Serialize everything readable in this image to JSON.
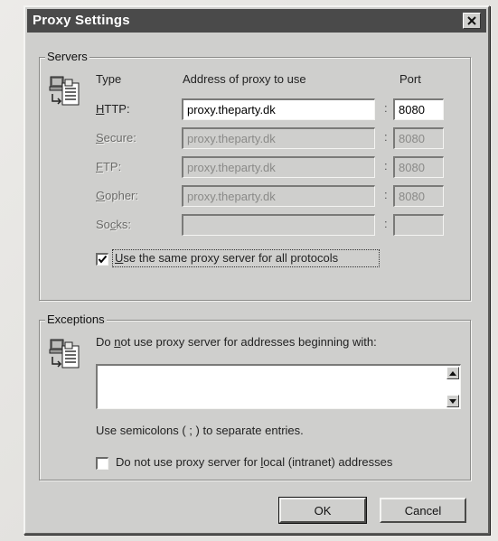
{
  "window": {
    "title": "Proxy Settings",
    "close_icon": "close-x-icon"
  },
  "servers": {
    "group_label": "Servers",
    "icon": "proxy-servers-icon",
    "col_type": "Type",
    "col_address": "Address of proxy to use",
    "col_port": "Port",
    "rows": [
      {
        "label": "HTTP:",
        "underline": "H",
        "rest": "TTP:",
        "address": "proxy.theparty.dk",
        "port": "8080",
        "enabled": true
      },
      {
        "label": "Secure:",
        "underline": "S",
        "rest": "ecure:",
        "address": "proxy.theparty.dk",
        "port": "8080",
        "enabled": false
      },
      {
        "label": "FTP:",
        "underline": "F",
        "rest": "TP:",
        "address": "proxy.theparty.dk",
        "port": "8080",
        "enabled": false
      },
      {
        "label": "Gopher:",
        "underline": "G",
        "rest": "opher:",
        "address": "proxy.theparty.dk",
        "port": "8080",
        "enabled": false
      },
      {
        "label": "Socks:",
        "underline": "c",
        "prefix": "So",
        "rest": "ks:",
        "address": "",
        "port": "",
        "enabled": false
      }
    ],
    "colon": ":",
    "same_proxy_checkbox": {
      "checked": true,
      "label_underline": "U",
      "label_rest": "se the same proxy server for all protocols"
    }
  },
  "exceptions": {
    "group_label": "Exceptions",
    "icon": "exceptions-icon",
    "prompt_pre": "Do ",
    "prompt_underline": "n",
    "prompt_post": "ot use proxy server for addresses beginning with:",
    "textarea_value": "",
    "hint": "Use semicolons ( ; ) to separate entries.",
    "local_checkbox": {
      "checked": false,
      "label_pre": "Do not use proxy server for ",
      "label_underline": "l",
      "label_post": "ocal (intranet) addresses"
    }
  },
  "buttons": {
    "ok": "OK",
    "cancel": "Cancel"
  }
}
